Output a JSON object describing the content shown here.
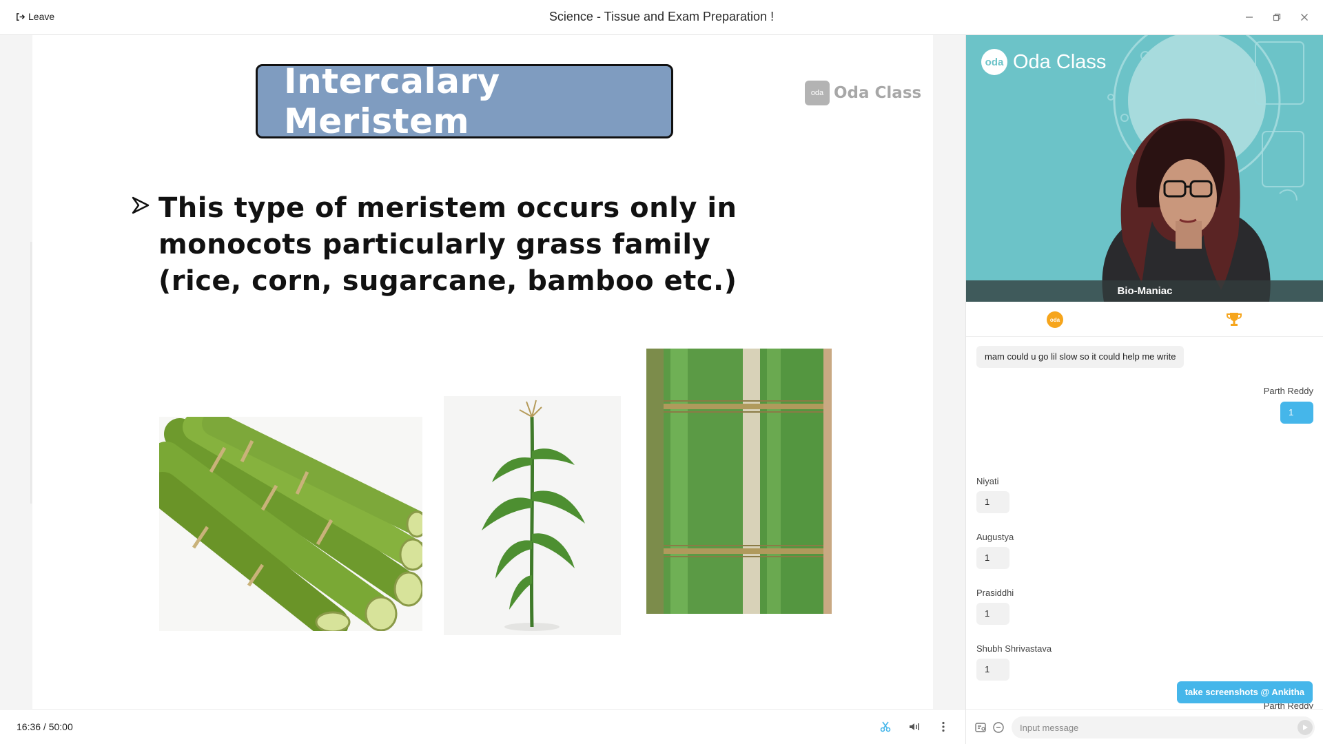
{
  "titlebar": {
    "leave_label": "Leave",
    "title": "Science - Tissue and Exam Preparation !"
  },
  "slide": {
    "title": "Intercalary Meristem",
    "logo_text": "Oda Class",
    "logo_mark": "oda",
    "bullet": "This type of meristem occurs only in monocots  particularly grass family (rice, corn, sugarcane, bamboo etc.)",
    "images": [
      "sugarcane",
      "corn-plant",
      "bamboo"
    ]
  },
  "player": {
    "time_current": "16:36",
    "time_total": "50:00",
    "time_display": "16:36 / 50:00"
  },
  "video": {
    "brand_mark": "oda",
    "brand_text": "Oda Class",
    "presenter_name": "Bio-Maniac"
  },
  "chat": {
    "messages": [
      {
        "sender": "",
        "text": "mam could u go lil slow so it could help me write",
        "outgoing": false
      },
      {
        "sender": "Parth Reddy",
        "text": "1",
        "outgoing": true
      },
      {
        "sender": "Niyati",
        "text": "1",
        "outgoing": false
      },
      {
        "sender": "Augustya",
        "text": "1",
        "outgoing": false
      },
      {
        "sender": "Prasiddhi",
        "text": "1",
        "outgoing": false
      },
      {
        "sender": "Shubh Shrivastava",
        "text": "1",
        "outgoing": false
      },
      {
        "sender": "Parth Reddy",
        "text": "take screenshots @ Ankitha",
        "outgoing": true
      }
    ],
    "input_placeholder": "Input message"
  },
  "colors": {
    "slide_title_bg": "#7f9cc0",
    "outgoing_bubble": "#45b6ea",
    "video_bg": "#6cc3c8",
    "coin": "#f6a51c"
  }
}
